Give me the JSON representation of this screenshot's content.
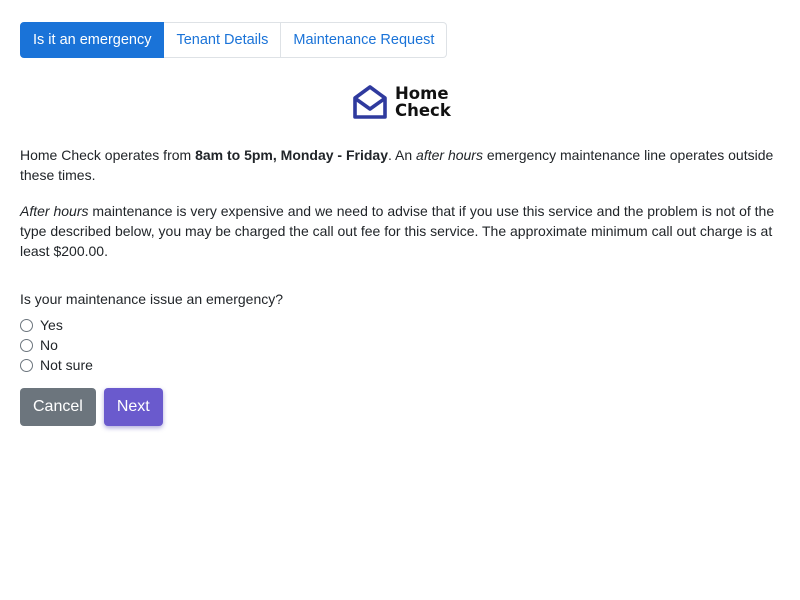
{
  "tabs": [
    {
      "label": "Is it an emergency",
      "active": true
    },
    {
      "label": "Tenant Details",
      "active": false
    },
    {
      "label": "Maintenance Request",
      "active": false
    }
  ],
  "logo": {
    "line1": "Home",
    "line2": "Check",
    "icon": "open-envelope-icon",
    "color": "#2f3a9e"
  },
  "intro": {
    "part1": "Home Check operates from ",
    "bold": "8am to 5pm, Monday - Friday",
    "part2": ". An ",
    "italic": "after hours",
    "part3": " emergency maintenance line operates outside these times."
  },
  "warning": {
    "italic": "After hours",
    "text": " maintenance is very expensive and we need to advise that if you use this service and the problem is not of the type described below, you may be charged the call out fee for this service. The approximate minimum call out charge is at least $200.00."
  },
  "question": "Is your maintenance issue an emergency?",
  "options": [
    "Yes",
    "No",
    "Not sure"
  ],
  "buttons": {
    "cancel": "Cancel",
    "next": "Next"
  },
  "colors": {
    "active_tab": "#1a73d8",
    "cancel_button": "#6c757d",
    "next_button": "#6a5acd"
  }
}
